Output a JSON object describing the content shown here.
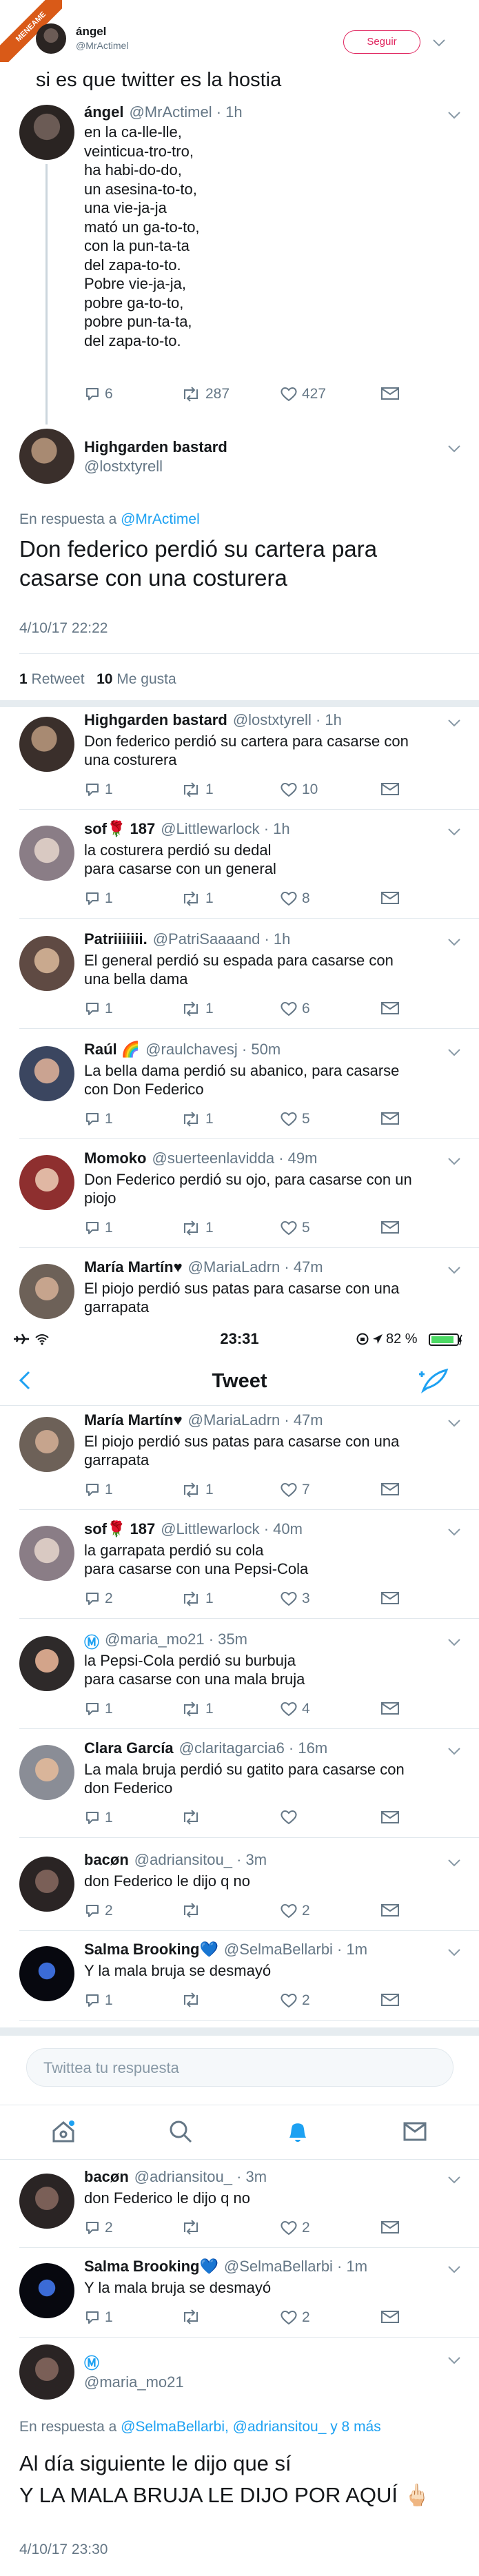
{
  "badge": "MENEAME",
  "top_header": {
    "name": "ángel",
    "handle": "@MrActimel",
    "follow_label": "Seguir",
    "tweet_text": "si es que twitter es la hostia"
  },
  "thread1": [
    {
      "name": "ángel",
      "handle": "@MrActimel · 1h",
      "lines": [
        "en la ca-lle-lle,",
        "veinticua-tro-tro,",
        "ha habi-do-do,",
        "un asesina-to-to,",
        "una vie-ja-ja",
        "mató un ga-to-to,",
        "con la pun-ta-ta",
        "del zapa-to-to.",
        "Pobre vie-ja-ja,",
        "pobre ga-to-to,",
        "pobre pun-ta-ta,",
        "del zapa-to-to."
      ],
      "replies": "6",
      "retweets": "287",
      "likes": "427"
    }
  ],
  "main_tweet": {
    "name": "Highgarden bastard",
    "handle": "@lostxtyrell",
    "reply_prefix": "En respuesta a",
    "reply_to": "@MrActimel",
    "text_lines": [
      "Don federico perdió su cartera para",
      "casarse con una costurera"
    ],
    "timestamp": "4/10/17 22:22",
    "retweets_count": "1",
    "retweets_label": "Retweet",
    "likes_count": "10",
    "likes_label": "Me gusta"
  },
  "replies_a": [
    {
      "name": "Highgarden bastard",
      "handle": "@lostxtyrell · 1h",
      "lines": [
        "Don federico perdió su cartera para casarse con",
        "una costurera"
      ],
      "r": "1",
      "rt": "1",
      "l": "10"
    },
    {
      "name": "sof🌹 187",
      "handle": "@Littlewarlock · 1h",
      "lines": [
        "la costurera perdió su dedal",
        "para casarse con un general"
      ],
      "r": "1",
      "rt": "1",
      "l": "8"
    },
    {
      "name": "Patriiiiiii.",
      "handle": "@PatriSaaaand · 1h",
      "lines": [
        "El general perdió su espada para casarse con",
        "una bella dama"
      ],
      "r": "1",
      "rt": "1",
      "l": "6"
    },
    {
      "name": "Raúl 🌈",
      "handle": "@raulchavesj · 50m",
      "lines": [
        "La bella dama perdió su abanico, para casarse",
        "con Don Federico"
      ],
      "r": "1",
      "rt": "1",
      "l": "5"
    },
    {
      "name": "Momoko",
      "handle": "@suerteenlavidda · 49m",
      "lines": [
        "Don Federico perdió su ojo, para casarse con un",
        "piojo"
      ],
      "r": "1",
      "rt": "1",
      "l": "5"
    },
    {
      "name": "María Martín♥",
      "handle": "@MariaLadrn · 47m",
      "lines": [
        "El piojo perdió sus patas para casarse con una",
        "garrapata"
      ],
      "r": "",
      "rt": "",
      "l": ""
    }
  ],
  "status_bar": {
    "time": "23:31",
    "battery": "82 %"
  },
  "nav": {
    "back_label": "<",
    "title": "Tweet"
  },
  "replies_b": [
    {
      "name": "María Martín♥",
      "handle": "@MariaLadrn · 47m",
      "lines": [
        "El piojo perdió sus patas para casarse con una",
        "garrapata"
      ],
      "r": "1",
      "rt": "1",
      "l": "7"
    },
    {
      "name": "sof🌹 187",
      "handle": "@Littlewarlock · 40m",
      "lines": [
        "la garrapata perdió su cola",
        "para casarse con una Pepsi-Cola"
      ],
      "r": "2",
      "rt": "1",
      "l": "3"
    },
    {
      "name": "Ⓜ",
      "handle": "@maria_mo21 · 35m",
      "lines": [
        "la Pepsi-Cola perdió su burbuja",
        "para casarse con una mala bruja"
      ],
      "r": "1",
      "rt": "1",
      "l": "4"
    },
    {
      "name": "Clara García",
      "handle": "@claritagarcia6 · 16m",
      "lines": [
        "La mala bruja perdió su gatito para casarse con",
        "don Federico"
      ],
      "r": "1",
      "rt": "",
      "l": ""
    },
    {
      "name": "bacøn",
      "handle": "@adriansitou_ · 3m",
      "lines": [
        "don Federico le dijo q no"
      ],
      "r": "2",
      "rt": "",
      "l": "2"
    },
    {
      "name": "Salma Brooking💙",
      "handle": "@SelmaBellarbi · 1m",
      "lines": [
        "Y la mala bruja se desmayó"
      ],
      "r": "1",
      "rt": "",
      "l": "2"
    }
  ],
  "reply_box": {
    "placeholder": "Twittea tu respuesta"
  },
  "replies_c": [
    {
      "name": "bacøn",
      "handle": "@adriansitou_ · 3m",
      "lines": [
        "don Federico le dijo q no"
      ],
      "r": "2",
      "rt": "",
      "l": "2"
    },
    {
      "name": "Salma Brooking💙",
      "handle": "@SelmaBellarbi · 1m",
      "lines": [
        "Y la mala bruja se desmayó"
      ],
      "r": "1",
      "rt": "",
      "l": "2"
    }
  ],
  "final_tweet": {
    "name": "Ⓜ",
    "handle": "@maria_mo21",
    "reply_prefix": "En respuesta a",
    "reply_to": "@SelmaBellarbi, @adriansitou_ y 8 más",
    "lines": [
      "Al día siguiente le dijo que sí",
      "Y LA MALA BRUJA LE DIJO POR AQUÍ 🖕🏻"
    ],
    "timestamp": "4/10/17 23:30"
  },
  "colors": {
    "accent": "#1da1f2",
    "muted": "#657786",
    "border": "#e1e8ed"
  }
}
